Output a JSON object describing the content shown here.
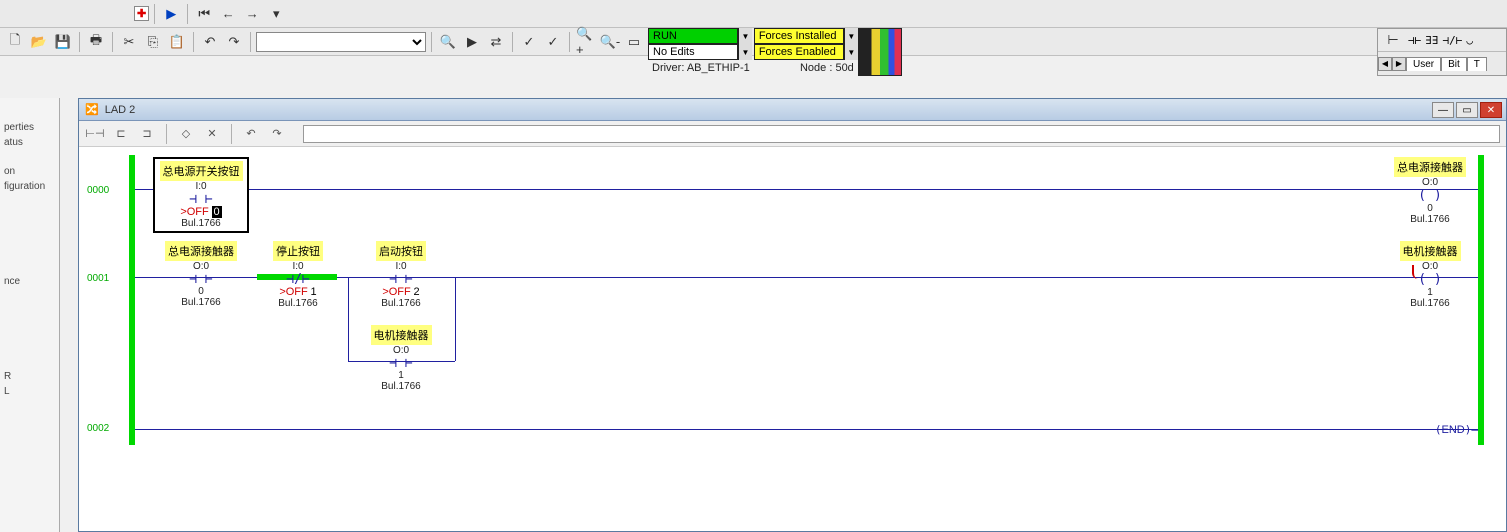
{
  "toolbar": {
    "combo_placeholder": ""
  },
  "status": {
    "run": "RUN",
    "forces_installed": "Forces Installed",
    "no_edits": "No Edits",
    "forces_enabled": "Forces Enabled",
    "driver": "Driver: AB_ETHIP-1",
    "node": "Node : 50d"
  },
  "right_tabs": {
    "user": "User",
    "bit": "Bit",
    "t": "T"
  },
  "left": {
    "perties": "perties",
    "atus": "atus",
    "on": "on",
    "figuration": "figuration",
    "nce": "nce",
    "r": "R",
    "l": "L"
  },
  "window": {
    "title": "LAD 2"
  },
  "rungs": {
    "r0": "0000",
    "r1": "0001",
    "r2": "0002"
  },
  "elements": {
    "main_pwr_btn": {
      "label": "总电源开关按钮",
      "addr": "I:0",
      "off": ">OFF",
      "bit": "0",
      "bul": "Bul.1766"
    },
    "main_pwr_cont_out": {
      "label": "总电源接触器",
      "addr": "O:0",
      "bit": "0",
      "bul": "Bul.1766"
    },
    "main_pwr_cont_in": {
      "label": "总电源接触器",
      "addr": "O:0",
      "bit": "0",
      "bul": "Bul.1766"
    },
    "stop_btn": {
      "label": "停止按钮",
      "addr": "I:0",
      "off": ">OFF",
      "bit": "1",
      "bul": "Bul.1766"
    },
    "start_btn": {
      "label": "启动按钮",
      "addr": "I:0",
      "off": ">OFF",
      "bit": "2",
      "bul": "Bul.1766"
    },
    "motor_cont_in": {
      "label": "电机接触器",
      "addr": "O:0",
      "bit": "1",
      "bul": "Bul.1766"
    },
    "motor_cont_out": {
      "label": "电机接触器",
      "addr": "O:0",
      "bit": "1",
      "bul": "Bul.1766"
    },
    "end": "END"
  },
  "left_btns": {
    "b1": "□",
    "b2": "✕"
  }
}
